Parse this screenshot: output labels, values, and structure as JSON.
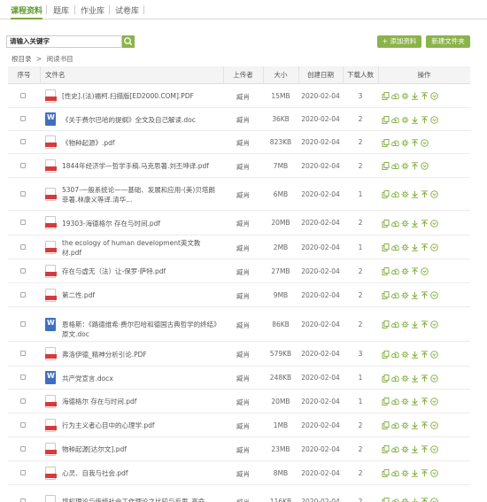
{
  "tabs": [
    "课程资料",
    "题库",
    "作业库",
    "试卷库"
  ],
  "search": {
    "placeholder": "请输入关键字",
    "value": "请输入关键字"
  },
  "buttons": {
    "add": "+ 添加资料",
    "new_folder": "新建文件夹"
  },
  "breadcrumb": {
    "root": "根目录",
    "separator": ">",
    "current": "阅读书目"
  },
  "columns": {
    "no": "序号",
    "name": "文件名",
    "uploader": "上传者",
    "size": "大小",
    "date": "创建日期",
    "downloads": "下载人数",
    "ops": "操作"
  },
  "colors": {
    "accent": "#8ab34a",
    "pdf": "#d63b3b",
    "doc": "#3f6fc0"
  },
  "icons": {
    "search": "search-icon",
    "pdf": "pdf-file-icon",
    "doc": "word-file-icon",
    "copy": "copy-icon",
    "upload": "cloud-upload-icon",
    "settings": "gear-icon",
    "download": "download-icon",
    "move_up": "move-up-icon",
    "expand": "chevron-down-circle-icon"
  },
  "rows": [
    {
      "type": "pdf",
      "name": "[性史].(法)福柯.扫描版[ED2000.COM].PDF",
      "uploader": "臧肖",
      "size": "15MB",
      "date": "2020-02-04",
      "downloads": "3"
    },
    {
      "type": "doc",
      "name": "《关于费尔巴哈的提纲》全文及自己解读.doc",
      "uploader": "臧肖",
      "size": "36KB",
      "date": "2020-02-04",
      "downloads": "2"
    },
    {
      "type": "pdf",
      "name": "《物种起源》.pdf",
      "uploader": "臧肖",
      "size": "823KB",
      "date": "2020-02-04",
      "downloads": "2"
    },
    {
      "type": "pdf",
      "name": "1844年经济学—哲学手稿.马克思著.刘丕坤译.pdf",
      "uploader": "臧肖",
      "size": "7MB",
      "date": "2020-02-04",
      "downloads": "2"
    },
    {
      "type": "pdf",
      "name": "5307-一般系统论——基础、发展和应用-(美)贝塔朗菲著.林康义等译.清华...",
      "uploader": "臧肖",
      "size": "6MB",
      "date": "2020-02-04",
      "downloads": "1"
    },
    {
      "type": "pdf",
      "name": "19303-海德格尔 存在与时间.pdf",
      "uploader": "臧肖",
      "size": "20MB",
      "date": "2020-02-04",
      "downloads": "2"
    },
    {
      "type": "pdf",
      "name": "the ecology of human development英文教材.pdf",
      "uploader": "臧肖",
      "size": "2MB",
      "date": "2020-02-04",
      "downloads": "1"
    },
    {
      "type": "pdf",
      "name": "存在与虚无（法）让-保罗·萨特.pdf",
      "uploader": "臧肖",
      "size": "27MB",
      "date": "2020-02-04",
      "downloads": "2"
    },
    {
      "type": "pdf",
      "name": "第二性.pdf",
      "uploader": "臧肖",
      "size": "9MB",
      "date": "2020-02-04",
      "downloads": "2"
    },
    {
      "type": "doc",
      "name": "恩格斯：《路德维希·费尔巴哈和德国古典哲学的终结》原文.doc",
      "uploader": "臧肖",
      "size": "86KB",
      "date": "2020-02-04",
      "downloads": "2"
    },
    {
      "type": "pdf",
      "name": "弗洛伊德_精神分析引论.PDF",
      "uploader": "臧肖",
      "size": "579KB",
      "date": "2020-02-04",
      "downloads": "3"
    },
    {
      "type": "doc",
      "name": "共产党宣言.docx",
      "uploader": "臧肖",
      "size": "248KB",
      "date": "2020-02-04",
      "downloads": "1"
    },
    {
      "type": "pdf",
      "name": "海德格尔 存在与时间.pdf",
      "uploader": "臧肖",
      "size": "20MB",
      "date": "2020-02-04",
      "downloads": "1"
    },
    {
      "type": "pdf",
      "name": "行为主义者心目中的心理学.pdf",
      "uploader": "臧肖",
      "size": "1MB",
      "date": "2020-02-04",
      "downloads": "2"
    },
    {
      "type": "pdf",
      "name": "物种起源[达尔文].pdf",
      "uploader": "臧肖",
      "size": "23MB",
      "date": "2020-02-04",
      "downloads": "2"
    },
    {
      "type": "pdf",
      "name": "心灵、自我与社会.pdf",
      "uploader": "臧肖",
      "size": "8MB",
      "date": "2020-02-04",
      "downloads": "2"
    },
    {
      "type": "pdf",
      "name": "增权理论与传统社会工作理论之比较与反思_高命敏.pdf",
      "uploader": "臧肖",
      "size": "116KB",
      "date": "2020-02-04",
      "downloads": "2"
    }
  ]
}
